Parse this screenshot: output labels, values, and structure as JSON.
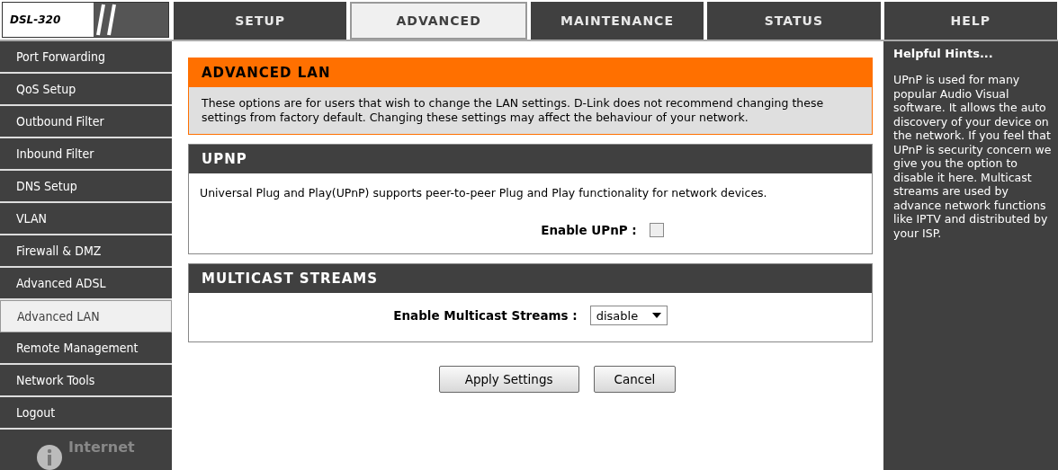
{
  "logo": {
    "model": "DSL-320"
  },
  "tabs": [
    {
      "label": "SETUP",
      "selected": false
    },
    {
      "label": "ADVANCED",
      "selected": true
    },
    {
      "label": "MAINTENANCE",
      "selected": false
    },
    {
      "label": "STATUS",
      "selected": false
    },
    {
      "label": "HELP",
      "selected": false
    }
  ],
  "sidebar": {
    "items": [
      {
        "label": "Port Forwarding",
        "selected": false
      },
      {
        "label": "QoS Setup",
        "selected": false
      },
      {
        "label": "Outbound Filter",
        "selected": false
      },
      {
        "label": "Inbound Filter",
        "selected": false
      },
      {
        "label": "DNS Setup",
        "selected": false
      },
      {
        "label": "VLAN",
        "selected": false
      },
      {
        "label": "Firewall & DMZ",
        "selected": false
      },
      {
        "label": "Advanced ADSL",
        "selected": false
      },
      {
        "label": "Advanced LAN",
        "selected": true
      },
      {
        "label": "Remote Management",
        "selected": false
      },
      {
        "label": "Network Tools",
        "selected": false
      },
      {
        "label": "Logout",
        "selected": false
      }
    ],
    "badge": "Internet"
  },
  "intro": {
    "title": "ADVANCED LAN",
    "text": "These options are for users that wish to change the LAN settings. D-Link does not recommend changing these settings from factory default. Changing these settings may affect the behaviour of your network."
  },
  "upnp": {
    "title": "UPNP",
    "text": "Universal Plug and Play(UPnP) supports peer-to-peer Plug and Play functionality for network devices.",
    "label": "Enable UPnP :",
    "checked": false
  },
  "multicast": {
    "title": "MULTICAST STREAMS",
    "label": "Enable Multicast Streams :",
    "value": "disable"
  },
  "buttons": [
    "Apply Settings",
    "Cancel"
  ],
  "hints": {
    "title": "Helpful Hints...",
    "text": "UPnP is used for many popular Audio Visual software. It allows the auto discovery of your device on the network. If you feel that UPnP is security concern we give you the option to disable it here. Multicast streams are used by advance network functions like IPTV and distributed by your ISP."
  }
}
